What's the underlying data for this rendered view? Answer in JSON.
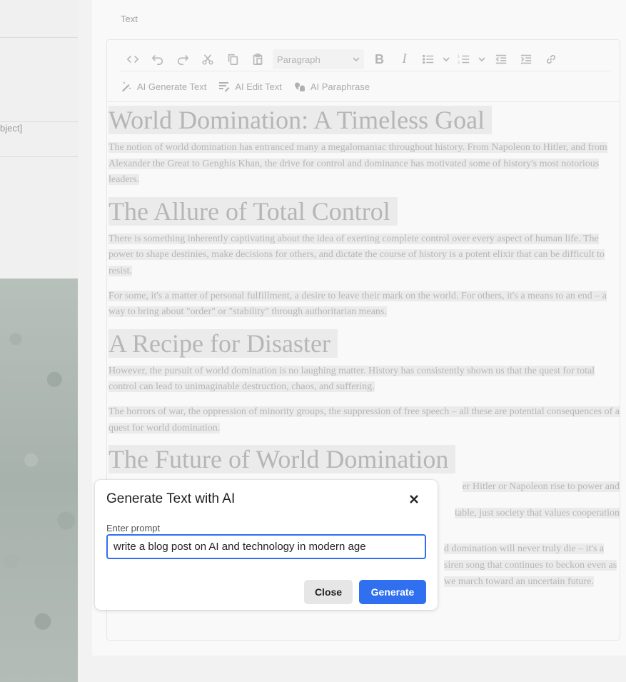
{
  "background": {
    "left_stub_text": "bject]"
  },
  "field": {
    "label": "Text"
  },
  "toolbar": {
    "block_format": "Paragraph",
    "icons": [
      "source-code-icon",
      "undo-icon",
      "redo-icon",
      "cut-icon",
      "copy-icon",
      "paste-icon",
      "bold-icon",
      "italic-icon",
      "bullet-list-icon",
      "numbered-list-icon",
      "outdent-icon",
      "indent-icon",
      "link-icon"
    ],
    "ai_generate": "AI Generate Text",
    "ai_edit": "AI Edit Text",
    "ai_paraphrase": "AI Paraphrase"
  },
  "document": {
    "h1": "World Domination: A Timeless Goal",
    "p1": "The notion of world domination has entranced many a megalomaniac throughout history. From Napoleon to Hitler, and from Alexander the Great to Genghis Khan, the drive for control and dominance has motivated some of history's most notorious leaders.",
    "h2": "The Allure of Total Control",
    "p2": "There is something inherently captivating about the idea of exerting complete control over every aspect of human life. The power to shape destinies, make decisions for others, and dictate the course of history is a potent elixir that can be difficult to resist.",
    "p3": "For some, it's a matter of personal fulfillment, a desire to leave their mark on the world. For others, it's a means to an end – a way to bring about \"order\" or \"stability\" through authoritarian means.",
    "h3": "A Recipe for Disaster",
    "p4": "However, the pursuit of world domination is no laughing matter. History has consistently shown us that the quest for total control can lead to unimaginable destruction, chaos, and suffering.",
    "p5": "The horrors of war, the oppression of minority groups, the suppression of free speech – all these are potential consequences of a quest for world domination.",
    "h4": "The Future of World Domination",
    "p6": "er Hitler or Napoleon rise to power and",
    "p7": "table, just society that values cooperation",
    "p8": "d domination will never truly die – it's a siren song that continues to beckon even as we march toward an uncertain future."
  },
  "modal": {
    "title": "Generate Text with AI",
    "prompt_label": "Enter prompt",
    "prompt_value": "write a blog post on AI and technology in modern age",
    "close_label": "Close",
    "generate_label": "Generate",
    "accent_color": "#2f6ff0"
  }
}
